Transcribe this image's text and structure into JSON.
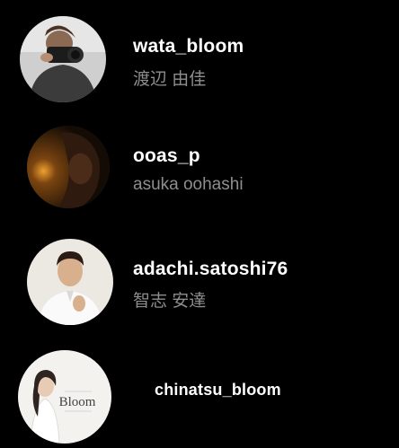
{
  "users": [
    {
      "username": "wata_bloom",
      "full_name": "渡辺 由佳",
      "avatar_icon": "person-with-camera-photo"
    },
    {
      "username": "ooas_p",
      "full_name": "asuka oohashi",
      "avatar_icon": "dim-portrait-photo"
    },
    {
      "username": "adachi.satoshi76",
      "full_name": "智志 安達",
      "avatar_icon": "man-in-white-shirt-photo"
    },
    {
      "username": "chinatsu_bloom",
      "avatar_icon": "bloom-logo-woman-photo",
      "avatar_logo_text": "Bloom"
    }
  ],
  "colors": {
    "background": "#000000",
    "username": "#ffffff",
    "full_name": "#8e8e8e"
  }
}
